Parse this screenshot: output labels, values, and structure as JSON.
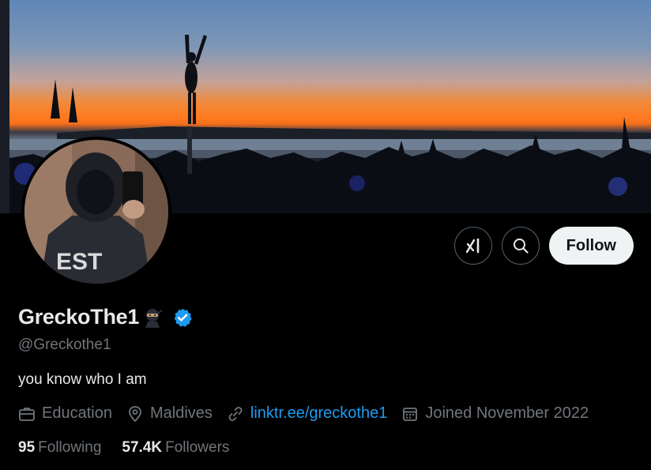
{
  "profile": {
    "display_name": "GreckoThe1",
    "handle": "@Greckothe1",
    "bio": "you know who I am",
    "verified": true,
    "name_emoji": "ninja-emoji"
  },
  "meta": {
    "category": "Education",
    "location": "Maldives",
    "link": "linktr.ee/greckothe1",
    "joined": "Joined November 2022"
  },
  "stats": {
    "following_count": "95",
    "following_label": "Following",
    "followers_count": "57.4K",
    "followers_label": "Followers"
  },
  "actions": {
    "follow_label": "Follow",
    "grok_icon": "grok-icon",
    "search_icon": "search-icon"
  },
  "colors": {
    "background": "#000000",
    "text_primary": "#e7e9ea",
    "text_secondary": "#71767b",
    "link": "#1d9bf0",
    "verified": "#1d9bf0",
    "follow_button_bg": "#eff3f4"
  }
}
